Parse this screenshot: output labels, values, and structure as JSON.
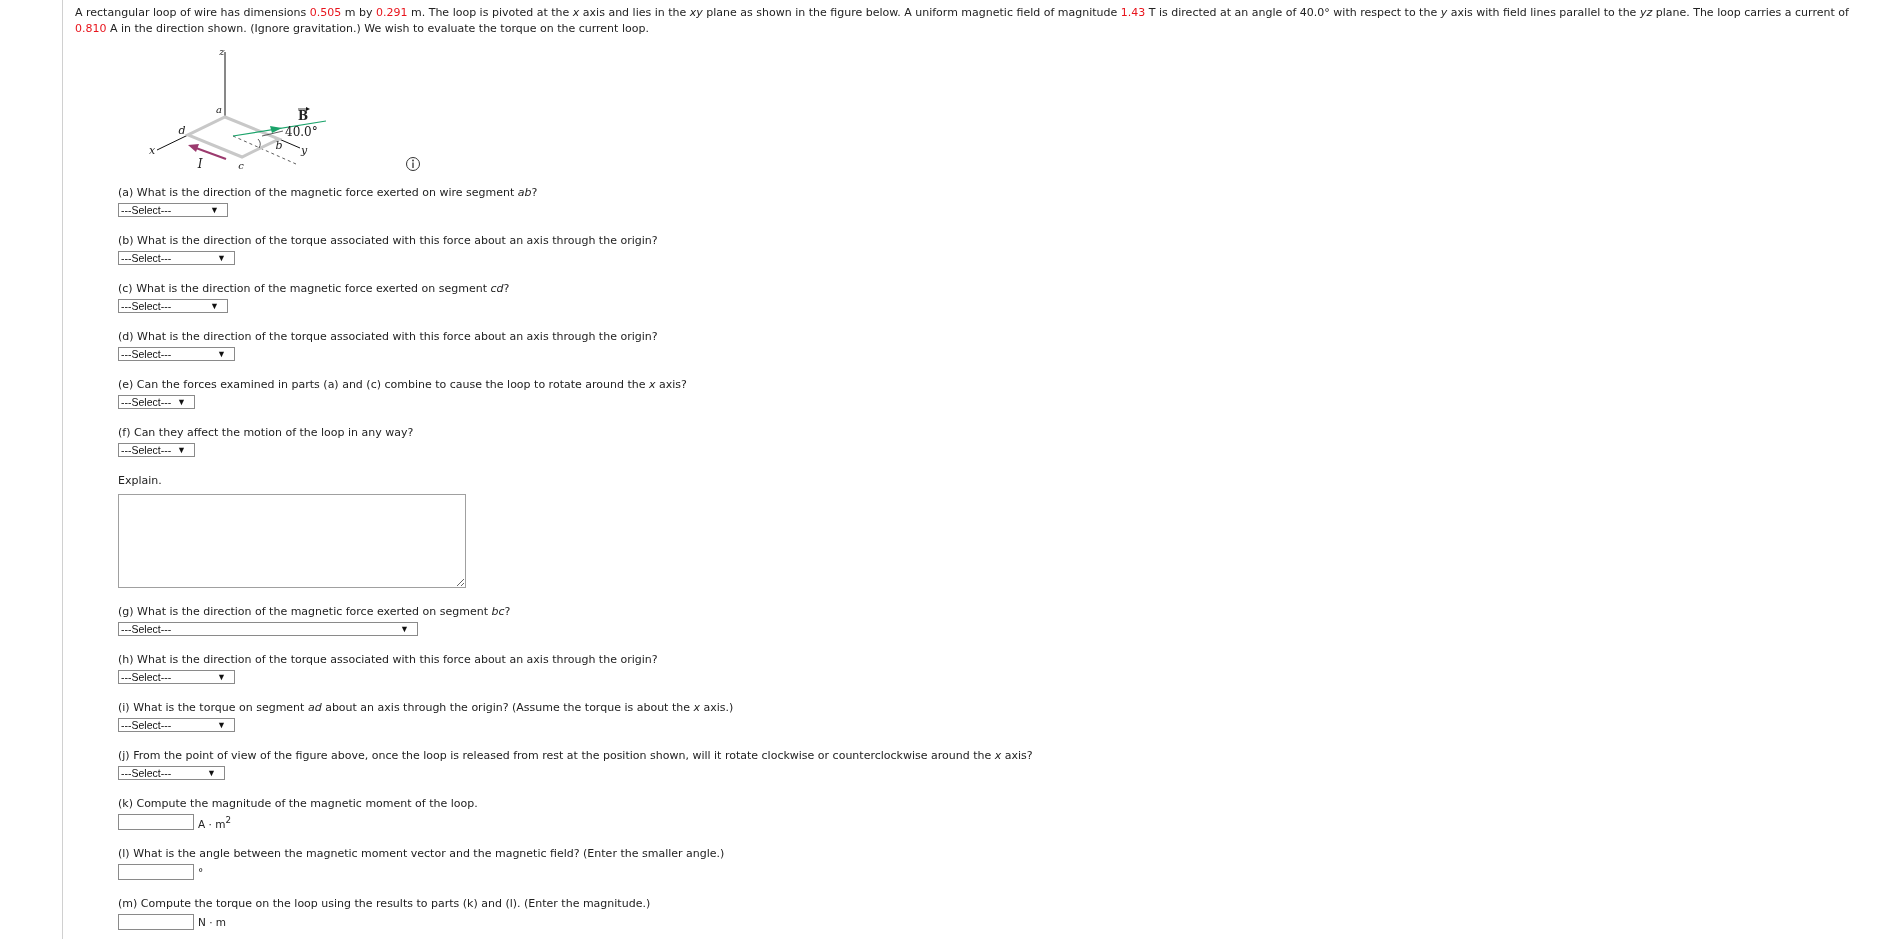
{
  "intro": [
    {
      "kind": "text",
      "text": "A rectangular loop of wire has dimensions "
    },
    {
      "kind": "value",
      "text": "0.505"
    },
    {
      "kind": "text",
      "text": " m by "
    },
    {
      "kind": "value",
      "text": "0.291"
    },
    {
      "kind": "text",
      "text": " m. The loop is pivoted at the *x* axis and lies in the *xy* plane as shown in the figure below. A uniform magnetic field of magnitude "
    },
    {
      "kind": "value",
      "text": "1.43"
    },
    {
      "kind": "text",
      "text": " T is directed at an angle of 40.0° with respect to the *y* axis with field lines parallel to the *yz* plane. The loop carries a current of "
    },
    {
      "kind": "value",
      "text": "0.810"
    },
    {
      "kind": "text",
      "text": " A in the direction shown. (Ignore gravitation.) We wish to evaluate the torque on the current loop."
    }
  ],
  "figure": {
    "labels": [
      {
        "kind": "z",
        "text": "z"
      },
      {
        "kind": "a",
        "text": "a"
      },
      {
        "kind": "B",
        "text": "B"
      },
      {
        "kind": "d",
        "text": "d"
      },
      {
        "kind": "angle",
        "text": "40.0°"
      },
      {
        "kind": "b",
        "text": "b"
      },
      {
        "kind": "x",
        "text": "x"
      },
      {
        "kind": "y",
        "text": "y"
      },
      {
        "kind": "I",
        "text": "I"
      },
      {
        "kind": "c",
        "text": "c"
      }
    ]
  },
  "questions": [
    {
      "kind": "select",
      "prompt": "(a) What is the direction of the magnetic force exerted on wire segment *ab*?",
      "value": "---Select---",
      "caret": "▼"
    },
    {
      "kind": "select",
      "prompt": "(b) What is the direction of the torque associated with this force about an axis through the origin?",
      "value": "---Select---",
      "caret": "▼"
    },
    {
      "kind": "select",
      "prompt": "(c) What is the direction of the magnetic force exerted on segment *cd*?",
      "value": "---Select---",
      "caret": "▼"
    },
    {
      "kind": "select",
      "prompt": "(d) What is the direction of the torque associated with this force about an axis through the origin?",
      "value": "---Select---",
      "caret": "▼"
    },
    {
      "kind": "select",
      "prompt": "(e) Can the forces examined in parts (a) and (c) combine to cause the loop to rotate around the *x* axis?",
      "value": "---Select---",
      "caret": "▼"
    },
    {
      "kind": "select",
      "prompt": "(f) Can they affect the motion of the loop in any way?",
      "value": "---Select---",
      "caret": "▼"
    },
    {
      "kind": "essay",
      "prompt": "Explain."
    },
    {
      "kind": "select",
      "prompt": "(g) What is the direction of the magnetic force exerted on segment *bc*?",
      "value": "---Select---",
      "caret": "▼"
    },
    {
      "kind": "select",
      "prompt": "(h) What is the direction of the torque associated with this force about an axis through the origin?",
      "value": "---Select---",
      "caret": "▼"
    },
    {
      "kind": "select",
      "prompt": "(i) What is the torque on segment *ad* about an axis through the origin? (Assume the torque is about the *x* axis.)",
      "value": "---Select---",
      "caret": "▼"
    },
    {
      "kind": "select",
      "prompt": "(j) From the point of view of the figure above, once the loop is released from rest at the position shown, will it rotate clockwise or counterclockwise around the *x* axis?",
      "value": "---Select---",
      "caret": "▼"
    },
    {
      "kind": "numeric",
      "prompt": "(k) Compute the magnitude of the magnetic moment of the loop.",
      "unit": "A · m$^{2}$"
    },
    {
      "kind": "numeric",
      "prompt": "(l) What is the angle between the magnetic moment vector and the magnetic field? (Enter the smaller angle.)",
      "unit": "°"
    },
    {
      "kind": "numeric",
      "prompt": "(m) Compute the torque on the loop using the results to parts (k) and (l). (Enter the magnitude.)",
      "unit": "N · m"
    }
  ]
}
